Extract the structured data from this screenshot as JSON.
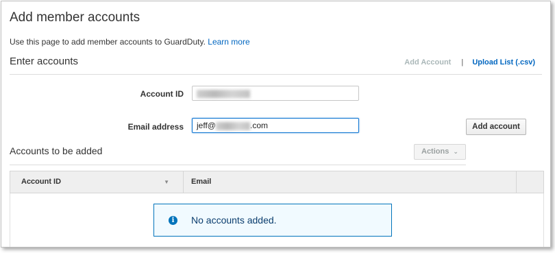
{
  "page": {
    "title": "Add member accounts",
    "description": "Use this page to add member accounts to GuardDuty.",
    "learn_more": "Learn more"
  },
  "enter_accounts": {
    "title": "Enter accounts",
    "add_account_link": "Add Account",
    "separator": "|",
    "upload_list_link": "Upload List (.csv)"
  },
  "form": {
    "account_id_label": "Account ID",
    "account_id_value": "",
    "email_label": "Email address",
    "email_prefix": "jeff@",
    "email_suffix": ".com",
    "add_button": "Add account"
  },
  "accounts_to_add": {
    "title": "Accounts to be added",
    "actions_label": "Actions",
    "columns": [
      "Account ID",
      "Email"
    ],
    "empty_message": "No accounts added."
  },
  "icons": {
    "sort": "caret-down-icon",
    "actions": "chevron-down-icon",
    "info": "info-icon"
  },
  "colors": {
    "link": "#0066c0",
    "info_border": "#0073bb",
    "focus": "#0b73d1"
  }
}
